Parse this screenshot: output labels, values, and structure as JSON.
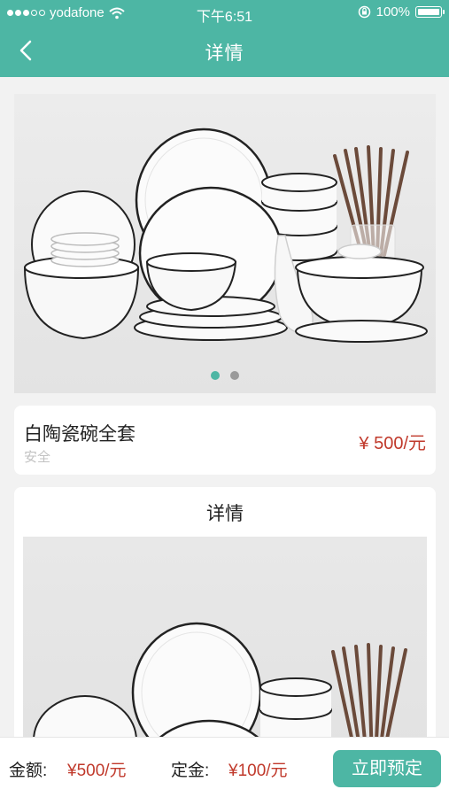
{
  "status_bar": {
    "carrier": "yodafone",
    "time": "下午6:51",
    "battery": "100%",
    "icons": [
      "signal-icon",
      "wifi-icon",
      "orientation-lock-icon",
      "battery-icon"
    ]
  },
  "nav": {
    "title": "详情",
    "back_icon": "chevron-left-icon"
  },
  "banner": {
    "dots_total": 2,
    "active_index": 0
  },
  "product": {
    "name": "白陶瓷碗全套",
    "subtitle": "安全",
    "price": "¥ 500/元"
  },
  "details": {
    "title": "详情"
  },
  "bottom_bar": {
    "amount_label": "金额:",
    "amount_value": "¥500/元",
    "deposit_label": "定金:",
    "deposit_value": "¥100/元",
    "reserve_button": "立即预定"
  },
  "colors": {
    "accent": "#4db6a4",
    "price": "#c0392b",
    "background": "#f2f2f2"
  }
}
